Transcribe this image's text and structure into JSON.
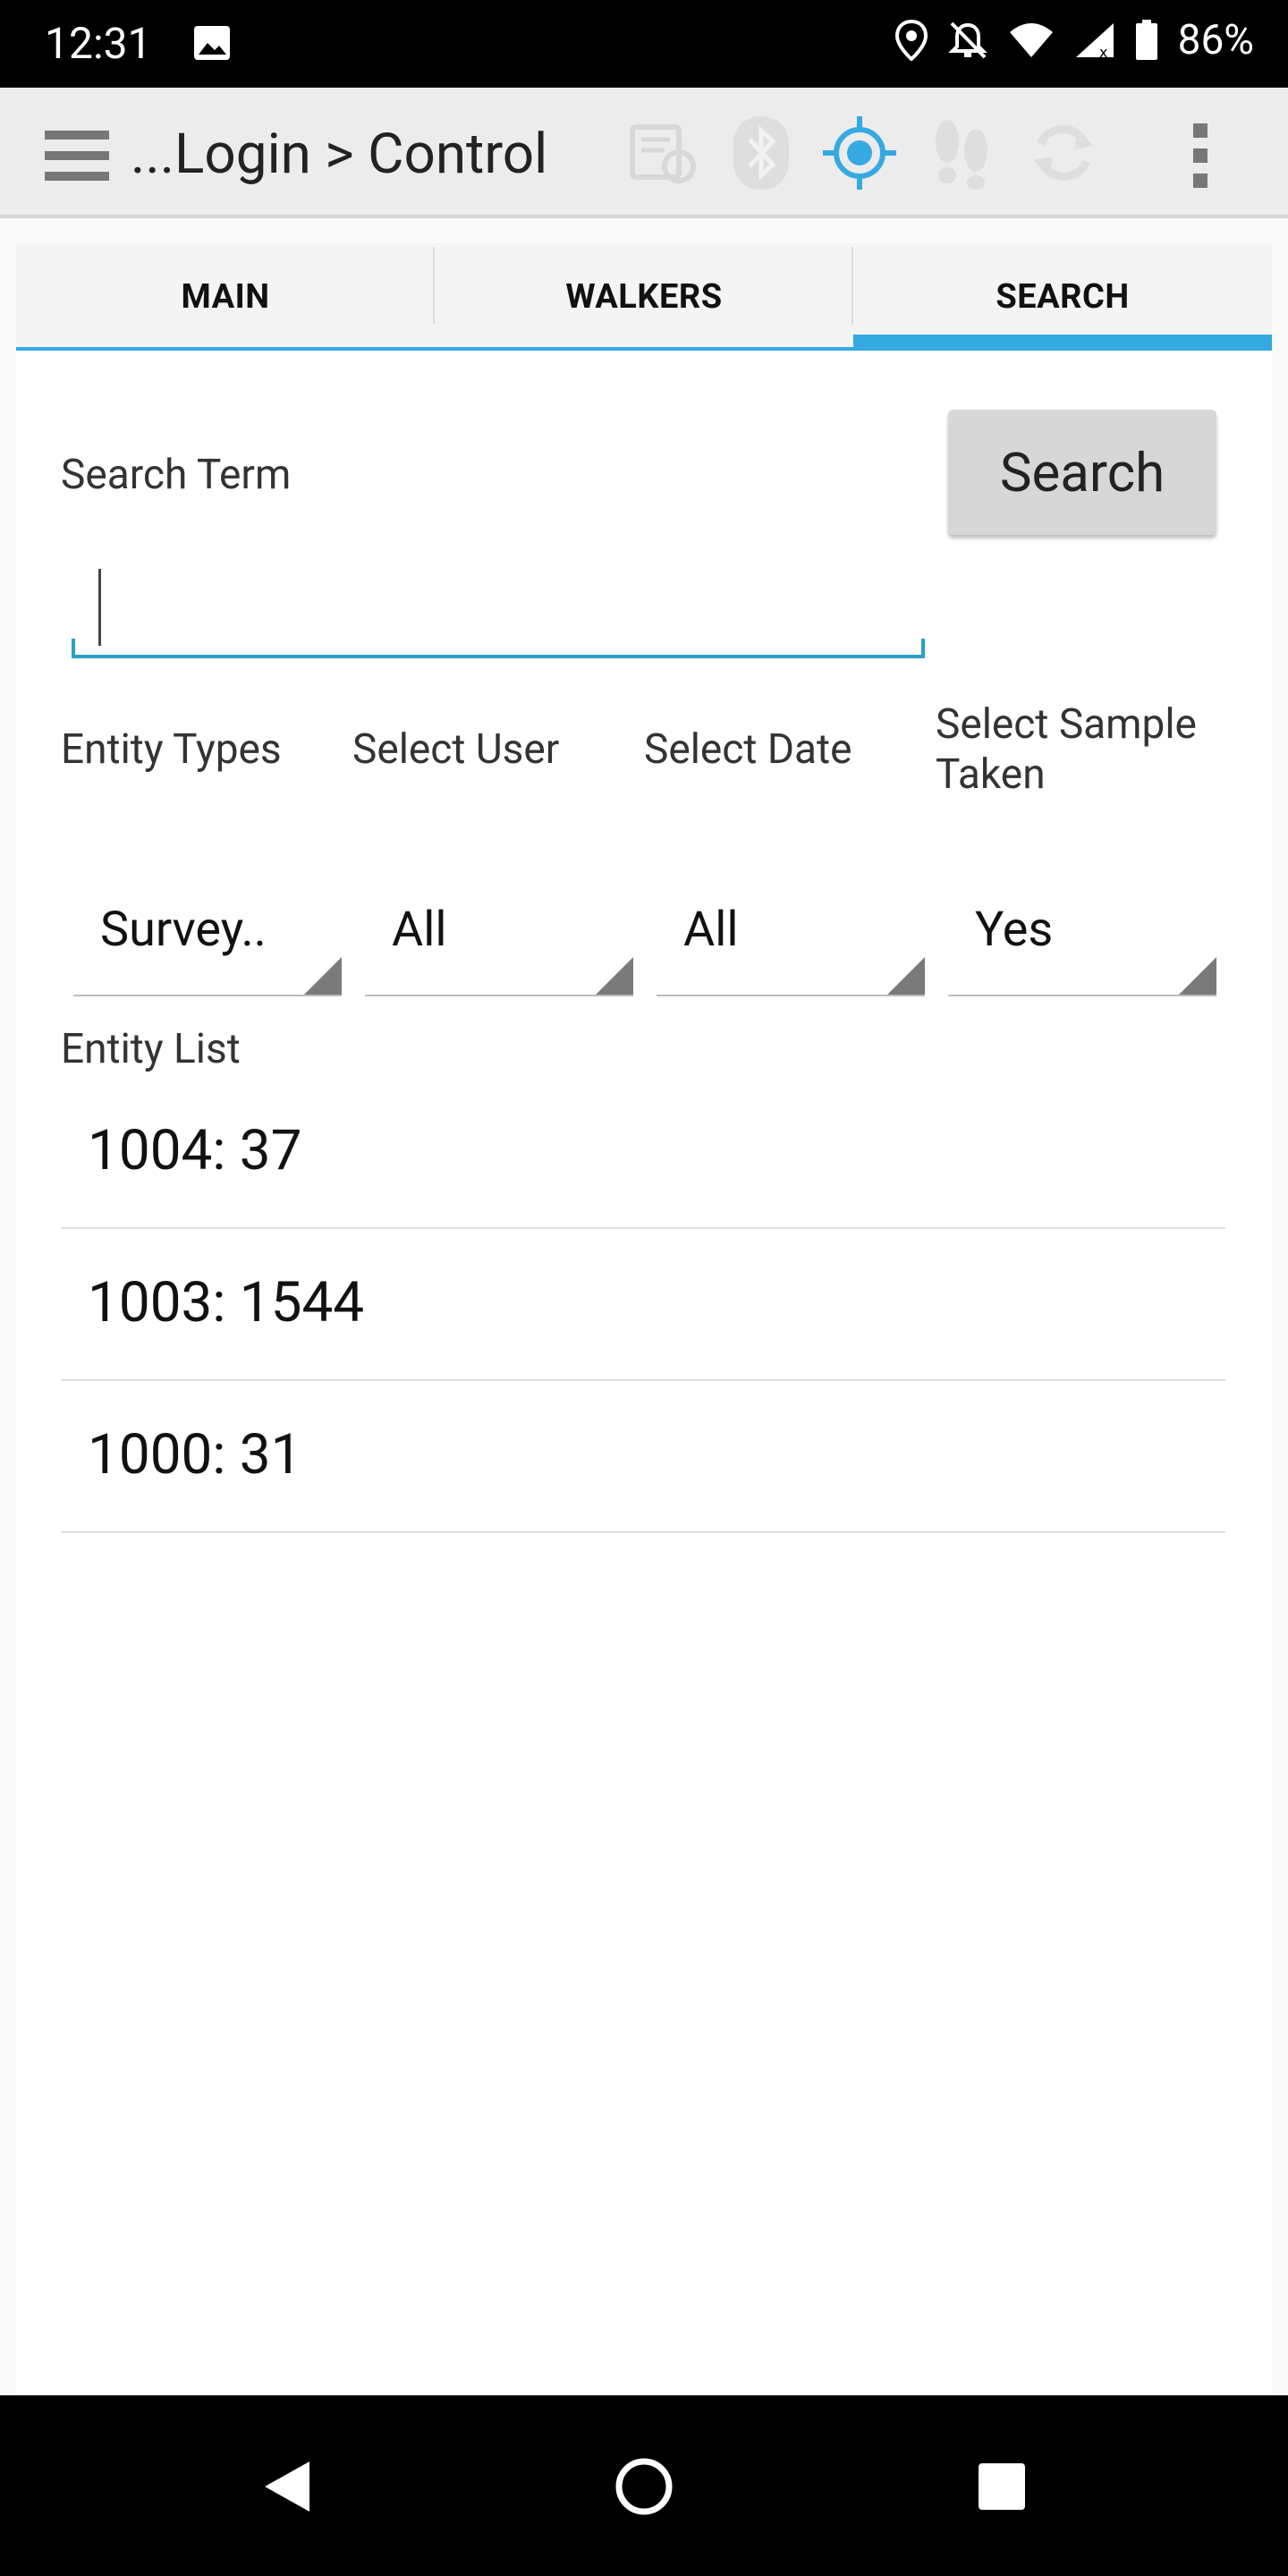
{
  "status_bar": {
    "time": "12:31",
    "battery": "86%",
    "icons": [
      "image-icon",
      "location-icon",
      "notifications-off-icon",
      "wifi-icon",
      "signal-icon",
      "battery-icon"
    ]
  },
  "app_bar": {
    "title": "...Login > Control",
    "icons": [
      "menu-icon",
      "sync-doc-icon",
      "bluetooth-icon",
      "gps-target-icon",
      "footsteps-icon",
      "refresh-icon",
      "overflow-menu-icon"
    ],
    "accent_color": "#35a9e1"
  },
  "tabs": [
    {
      "label": "MAIN",
      "active": false
    },
    {
      "label": "WALKERS",
      "active": false
    },
    {
      "label": "SEARCH",
      "active": true
    }
  ],
  "search": {
    "term_label": "Search Term",
    "button_label": "Search",
    "input_value": "",
    "input_placeholder": ""
  },
  "filters": {
    "entity_types": {
      "label": "Entity Types",
      "value": "Survey.."
    },
    "select_user": {
      "label": "Select User",
      "value": "All"
    },
    "select_date": {
      "label": "Select Date",
      "value": "All"
    },
    "sample_taken": {
      "label": "Select Sample Taken",
      "value": "Yes"
    }
  },
  "entity_list": {
    "label": "Entity List",
    "items": [
      "1004: 37",
      "1003: 1544",
      "1000: 31"
    ]
  },
  "nav_bar": {
    "icons": [
      "back-icon",
      "home-icon",
      "recents-icon"
    ]
  }
}
